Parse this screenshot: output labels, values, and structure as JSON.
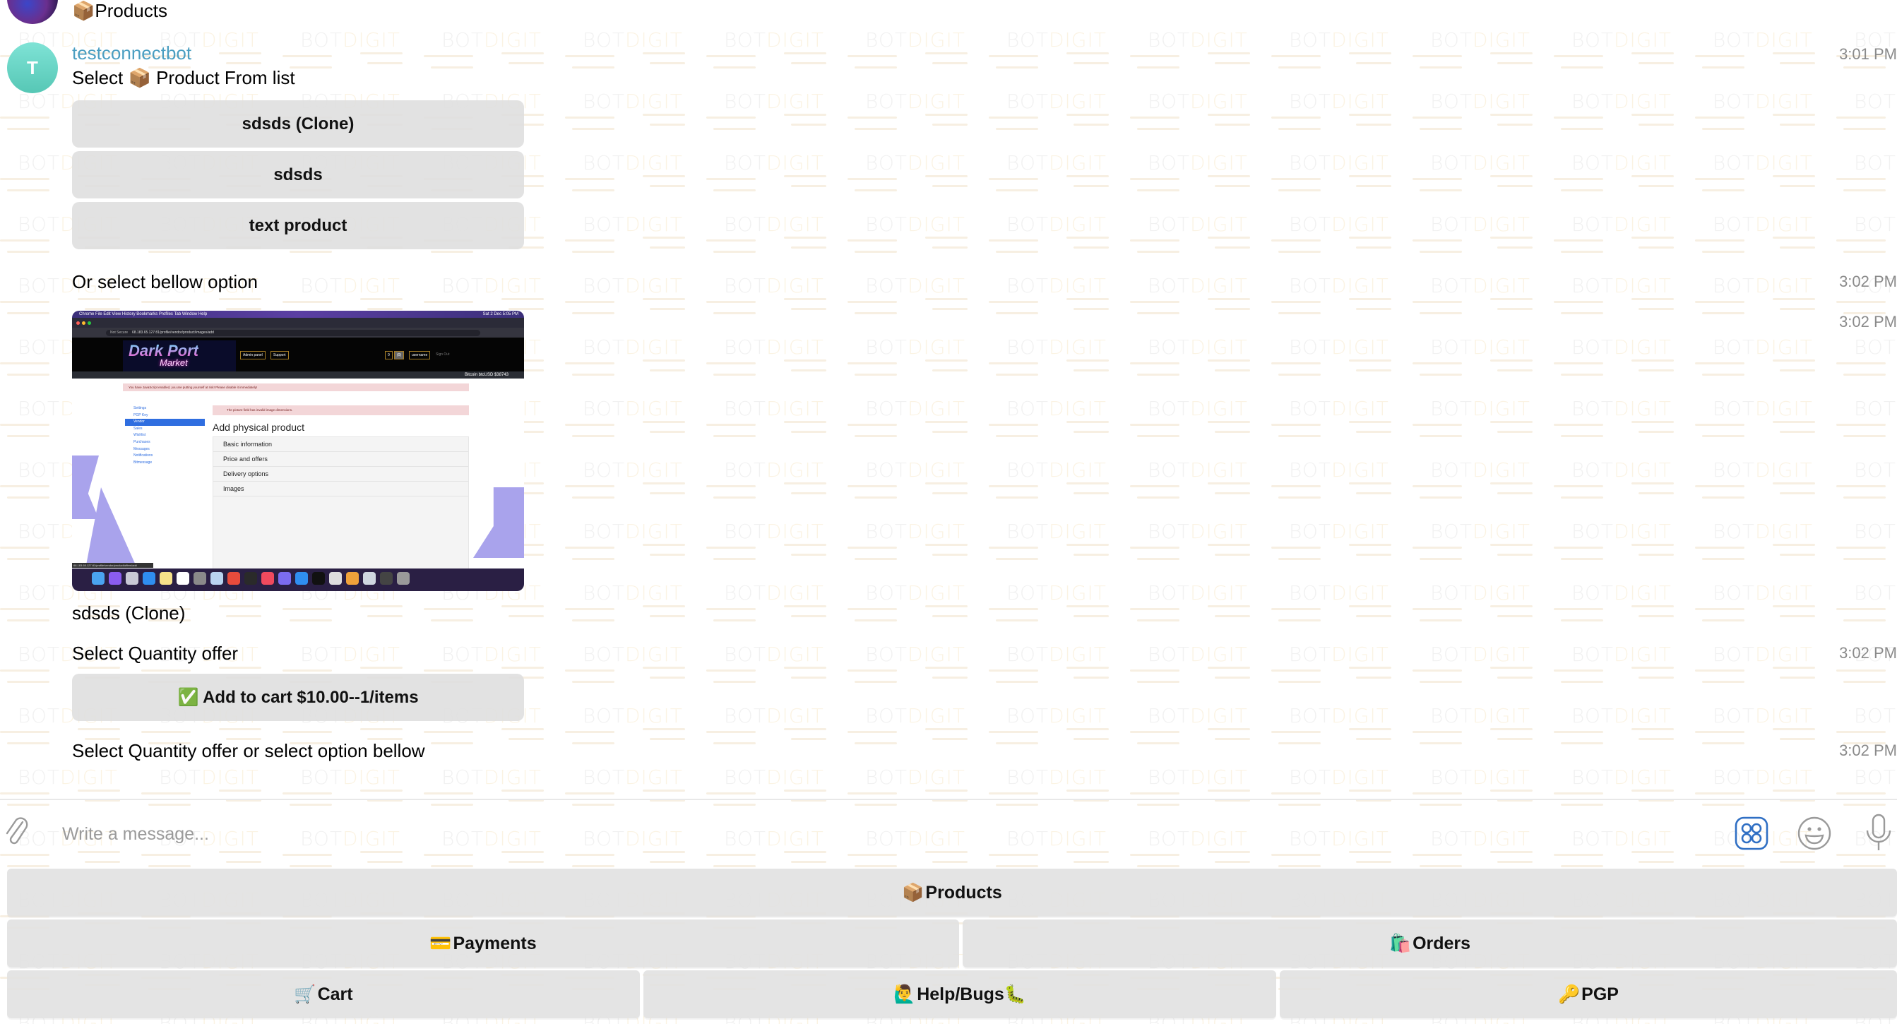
{
  "chat": {
    "previous_message": {
      "text": "📦Products"
    },
    "bot": {
      "name": "testconnectbot",
      "avatar_letter": "T",
      "avatar_color": "#5fd0bf",
      "name_color": "#4b9ec1"
    },
    "messages": [
      {
        "text": "Select 📦 Product From list",
        "time": "3:01 PM",
        "buttons": [
          "sdsds (Clone)",
          "sdsds",
          "text product"
        ]
      },
      {
        "text": "Or select bellow option",
        "time": "3:02 PM"
      },
      {
        "type": "photo",
        "time": "3:02 PM",
        "caption": "sdsds (Clone)",
        "photo": {
          "menubar": [
            "Chrome",
            "File",
            "Edit",
            "View",
            "History",
            "Bookmarks",
            "Profiles",
            "Tab",
            "Window",
            "Help"
          ],
          "menubar_clock": "Sat 2 Dec 5:05 PM",
          "url_warning": "Not Secure",
          "url": "68.183.65.127:81/profile/vendor/product/images/add",
          "logo_title": "Dark Port",
          "logo_subtitle": "Market",
          "header_links": [
            "Admin panel",
            "Support"
          ],
          "header_right": [
            "0",
            "(0)",
            "username",
            "Sign Out"
          ],
          "price_ticker": "Bitcoin btcUSD $38743",
          "js_warning": "You have JavaScript enabled, you are putting yourself at risk! Please disable it immediately!",
          "form_error": "The picture field has invalid image dimensions.",
          "sidebar": [
            "Settings",
            "PGP Key",
            "Vendor",
            "Sales",
            "Wishlist",
            "Purchases",
            "Messages",
            "Notifications",
            "Bitmessage"
          ],
          "sidebar_active": "Vendor",
          "page_title": "Add physical product",
          "sections": [
            "Basic information",
            "Price and offers",
            "Delivery options",
            "Images"
          ],
          "status_url": "68.183.65.127:81/profile/vendor/product/offers/add"
        }
      },
      {
        "text": "Select Quantity offer",
        "time": "3:02 PM",
        "buttons": [
          "✅ Add to cart $10.00--1/items"
        ]
      },
      {
        "text": "Select Quantity offer or select option bellow",
        "time": "3:02 PM"
      }
    ]
  },
  "composer": {
    "placeholder": "Write a message...",
    "value": ""
  },
  "reply_keyboard": {
    "rows": [
      [
        {
          "emoji": "📦",
          "label": "Products"
        }
      ],
      [
        {
          "emoji": "💳",
          "label": "Payments"
        },
        {
          "emoji": "🛍️",
          "label": "Orders"
        }
      ],
      [
        {
          "emoji": "🛒",
          "label": "Cart"
        },
        {
          "emoji": "🙋‍♂️",
          "label": "Help/Bugs🐛"
        },
        {
          "emoji": "🔑",
          "label": "PGP"
        }
      ]
    ]
  },
  "watermark": {
    "word_a": "BOT",
    "word_b": "DIGIT"
  }
}
